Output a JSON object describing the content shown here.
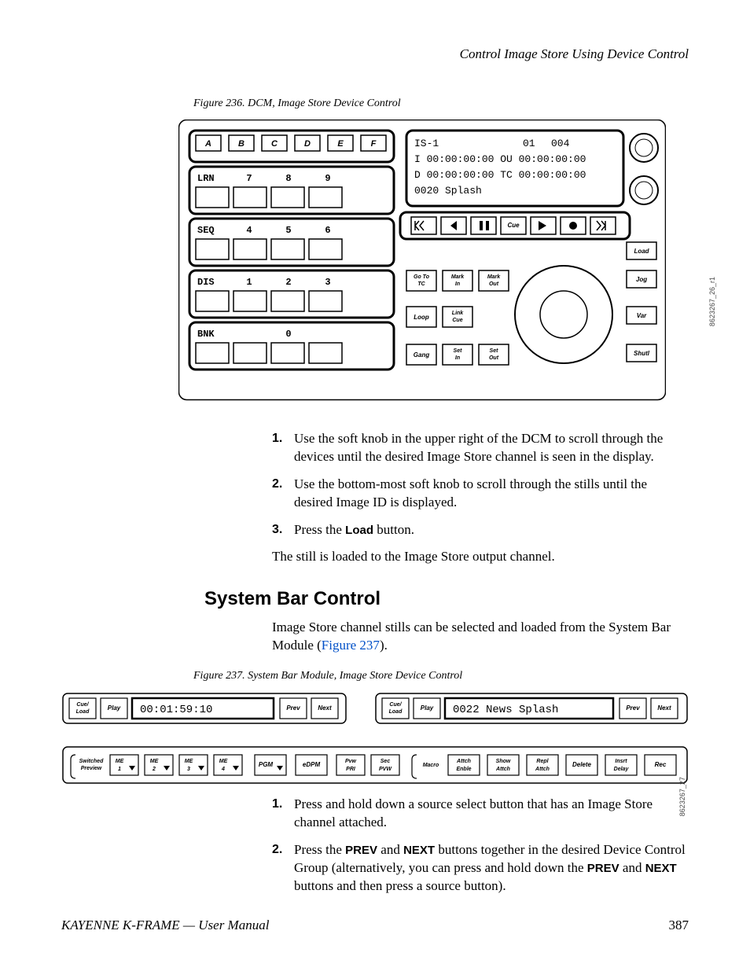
{
  "running_head": "Control Image Store Using Device Control",
  "figure236": {
    "caption": "Figure 236.  DCM, Image Store Device Control",
    "side_id": "8623267_26_r1",
    "top_row_letters": [
      "A",
      "B",
      "C",
      "D",
      "E",
      "F"
    ],
    "rows": [
      {
        "mode": "LRN",
        "labels": [
          "7",
          "8",
          "9"
        ]
      },
      {
        "mode": "SEQ",
        "labels": [
          "4",
          "5",
          "6"
        ]
      },
      {
        "mode": "DIS",
        "labels": [
          "1",
          "2",
          "3"
        ]
      },
      {
        "mode": "BNK",
        "labels": [
          "",
          "0",
          ""
        ]
      }
    ],
    "lcd": {
      "line1_left": "IS-1",
      "line1_mid": "01",
      "line1_right": "004",
      "line2": "I 00:00:00:00 OU 00:00:00:00",
      "line3": "D 00:00:00:00 TC 00:00:00:00",
      "line4": "0020 Splash"
    },
    "transport": {
      "cue": "Cue"
    },
    "right_small": {
      "load": "Load",
      "jog": "Jog",
      "var": "Var",
      "shutl": "Shutl"
    },
    "left_col": {
      "goto_tc": [
        "Go To",
        "TC"
      ],
      "loop": "Loop",
      "gang": "Gang"
    },
    "mid_col1": {
      "mark_in": [
        "Mark",
        "In"
      ],
      "link_cue": [
        "Link",
        "Cue"
      ],
      "set_in": [
        "Set",
        "In"
      ]
    },
    "mid_col2": {
      "mark_out": [
        "Mark",
        "Out"
      ],
      "set_out": [
        "Set",
        "Out"
      ]
    }
  },
  "steps_a": [
    "Use the soft knob in the upper right of the DCM to scroll through the devices until the desired Image Store channel is seen in the display.",
    "Use the bottom-most soft knob to scroll through the stills until the desired Image ID is displayed.",
    "Press the |Load| button."
  ],
  "after_steps_a": "The still is loaded to the Image Store output channel.",
  "section_heading": "System Bar Control",
  "section_intro_pre": "Image Store channel stills can be selected and loaded from the System Bar Module (",
  "section_intro_link": "Figure 237",
  "section_intro_post": ").",
  "figure237": {
    "caption": "Figure 237.  System Bar Module, Image Store Device Control",
    "side_id": "8623267_27",
    "group_a": {
      "cue_load": [
        "Cue/",
        "Load"
      ],
      "play": "Play",
      "display": "00:01:59:10",
      "prev": "Prev",
      "next": "Next"
    },
    "group_b": {
      "cue_load": [
        "Cue/",
        "Load"
      ],
      "play": "Play",
      "display": "0022 News Splash",
      "prev": "Prev",
      "next": "Next"
    },
    "bottom": {
      "switched": [
        "Switched",
        "Preview"
      ],
      "me": [
        [
          "ME",
          "1"
        ],
        [
          "ME",
          "2"
        ],
        [
          "ME",
          "3"
        ],
        [
          "ME",
          "4"
        ]
      ],
      "pgm": "PGM",
      "edpm": "eDPM",
      "pvw_pri": [
        "Pvw",
        "PRI"
      ],
      "sec_pvw": [
        "Sec",
        "PVW"
      ],
      "macro": "Macro",
      "attch_enble": [
        "Attch",
        "Enble"
      ],
      "show_attch": [
        "Show",
        "Attch"
      ],
      "repl_attch": [
        "Repl",
        "Attch"
      ],
      "delete": "Delete",
      "insrt_delay": [
        "Insrt",
        "Delay"
      ],
      "rec": "Rec"
    }
  },
  "steps_b": [
    "Press and hold down a source select button that has an Image Store channel attached.",
    "Press the |PREV| and |NEXT| buttons together in the desired Device Control Group (alternatively, you can press and hold down the |PREV| and |NEXT| buttons and then press a source button)."
  ],
  "footer_left": "KAYENNE K-FRAME — User Manual",
  "footer_right": "387"
}
